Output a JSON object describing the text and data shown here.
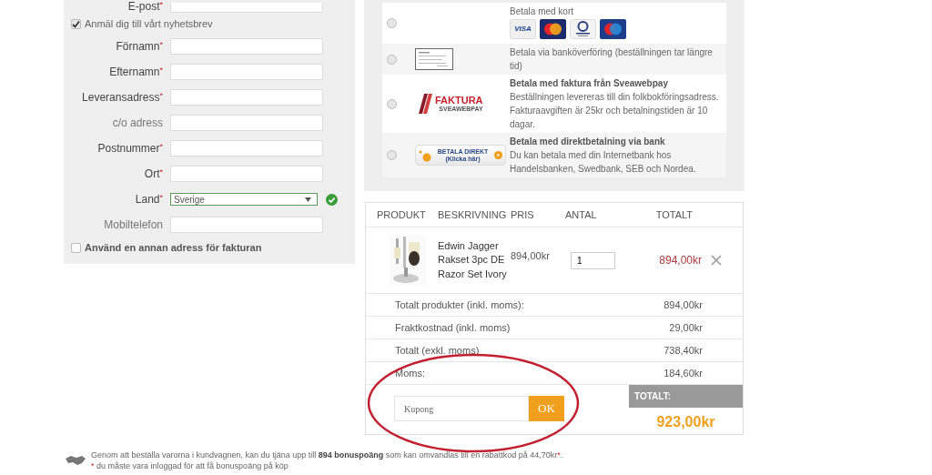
{
  "customer_form": {
    "email_label": {
      "label": "E-post",
      "mark": "*"
    },
    "newsletter": {
      "label": "Anmäl dig till vårt nyhetsbrev",
      "checked": true
    },
    "fields": [
      {
        "label": "Förnamn",
        "mark": "*",
        "kind": "text"
      },
      {
        "label": "Efternamn",
        "mark": "*",
        "kind": "text"
      },
      {
        "label": "Leveransadress",
        "mark": "*",
        "kind": "text"
      },
      {
        "label": "c/o adress",
        "kind": "text"
      },
      {
        "label": "Postnummer",
        "mark": "*",
        "kind": "text"
      },
      {
        "label": "Ort",
        "mark": "*",
        "kind": "text"
      },
      {
        "label": "Land",
        "mark": "*",
        "kind": "select",
        "value": "Sverige",
        "valid": true
      },
      {
        "label": "Mobiltelefon",
        "kind": "text"
      }
    ],
    "other_billing_address": {
      "label": "Använd en annan adress för fakturan",
      "checked": false
    }
  },
  "payment_methods": [
    {
      "kind": "cards",
      "selected": false,
      "title": "Betala med kort",
      "cards": [
        {
          "kind": "visa",
          "label": "VISA"
        },
        {
          "kind": "mastercard"
        },
        {
          "kind": "diners"
        },
        {
          "kind": "maestro"
        }
      ]
    },
    {
      "kind": "bank",
      "selected": false,
      "text": "Betala via banköverföring (beställningen tar längre tid)"
    },
    {
      "kind": "faktura",
      "selected": false,
      "logo": "FAKTURA",
      "logo_sub": "SVEAWEBPAY",
      "title": "Betala med faktura från Sveawebpay",
      "text": "Beställningen levereras till din folkbokföringsadress. Fakturaavgiften är 25kr och betalningstiden är 10 dagar."
    },
    {
      "kind": "direkt",
      "selected": false,
      "logo": "BETALA DIREKT",
      "logo_sub": "(Klicka här)",
      "title": "Betala med direktbetalning via bank",
      "text": "Du kan betala med din Internetbank hos Handelsbanken, Swedbank, SEB och Nordea."
    }
  ],
  "cart": {
    "columns": [
      "PRODUKT",
      "BESKRIVNING",
      "PRIS",
      "ANTAL",
      "TOTALT"
    ],
    "rows": [
      {
        "description": "Edwin Jagger Rakset 3pc DE Razor Set Ivory",
        "price": "894,00kr",
        "quantity": "1",
        "total": "894,00kr"
      }
    ],
    "summary": [
      {
        "label": "Totalt produkter (inkl. moms):",
        "value": "894,00kr"
      },
      {
        "label": "Fraktkostnad (inkl. moms)",
        "value": "29,00kr"
      },
      {
        "label": "Totalt (exkl. moms)",
        "value": "738,40kr"
      },
      {
        "label": "Moms:",
        "value": "184,60kr"
      }
    ],
    "coupon": {
      "placeholder": "Kupong",
      "button": "OK"
    },
    "grand_total": {
      "label": "TOTALT:",
      "value": "923,00kr"
    }
  },
  "bonus_note": {
    "lines": [
      [
        {
          "text": "Genom att beställa varorna i kundvagnen, kan du tjäna upp till **894 bonuspoäng** som kan omvandlas till en rabattkod på 44,70kr"
        },
        {
          "text": "*",
          "kind": "mark"
        },
        {
          "text": "."
        }
      ],
      [
        {
          "text": "*",
          "kind": "mark"
        },
        {
          "text": " du måste vara inloggad för att få bonuspoäng på köp"
        }
      ]
    ]
  }
}
